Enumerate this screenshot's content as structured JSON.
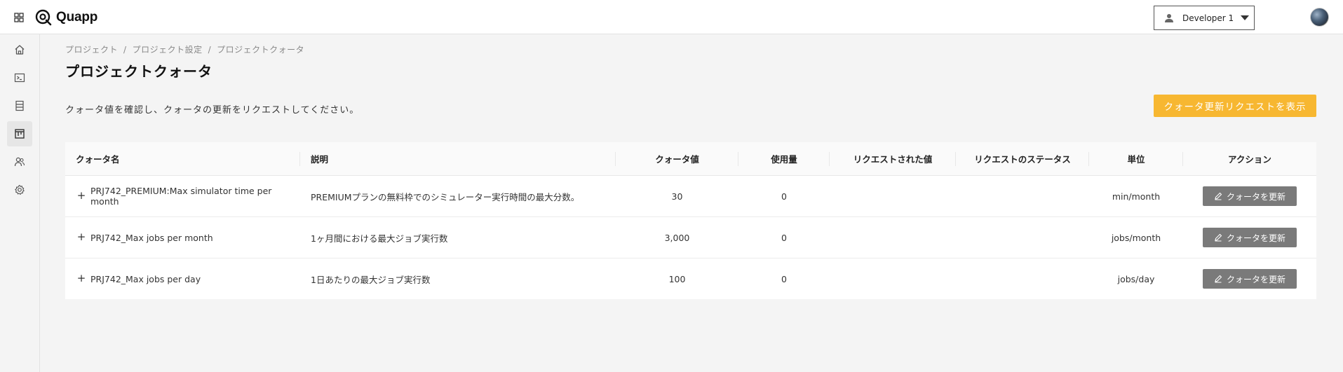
{
  "header": {
    "logo_text": "Quapp",
    "user_name": "Developer 1"
  },
  "breadcrumb": [
    "プロジェクト",
    "プロジェクト設定",
    "プロジェクトクォータ"
  ],
  "page": {
    "title": "プロジェクトクォータ",
    "description": "クォータ値を確認し、クォータの更新をリクエストしてください。",
    "request_button": "クォータ更新リクエストを表示"
  },
  "table": {
    "headers": {
      "name": "クォータ名",
      "description": "説明",
      "quota": "クォータ値",
      "usage": "使用量",
      "requested": "リクエストされた値",
      "status": "リクエストのステータス",
      "unit": "単位",
      "action": "アクション"
    },
    "rows": [
      {
        "name": "PRJ742_PREMIUM:Max simulator time per month",
        "description": "PREMIUMプランの無料枠でのシミュレーター実行時間の最大分数。",
        "quota": "30",
        "usage": "0",
        "requested": "",
        "status": "",
        "unit": "min/month",
        "action": "クォータを更新"
      },
      {
        "name": "PRJ742_Max jobs per month",
        "description": "1ヶ月間における最大ジョブ実行数",
        "quota": "3,000",
        "usage": "0",
        "requested": "",
        "status": "",
        "unit": "jobs/month",
        "action": "クォータを更新"
      },
      {
        "name": "PRJ742_Max jobs per day",
        "description": "1日あたりの最大ジョブ実行数",
        "quota": "100",
        "usage": "0",
        "requested": "",
        "status": "",
        "unit": "jobs/day",
        "action": "クォータを更新"
      }
    ]
  },
  "colors": {
    "accent": "#f7b731",
    "action_button": "#7a7a7a"
  }
}
